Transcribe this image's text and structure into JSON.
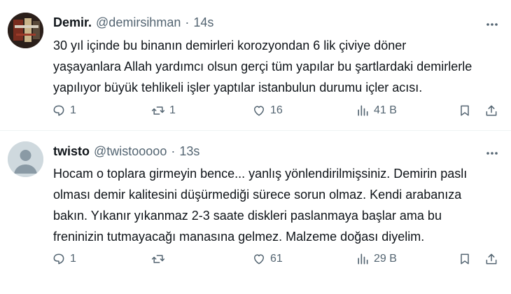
{
  "tweets": [
    {
      "name": "Demir.",
      "handle": "@demirsihman",
      "separator": "·",
      "time": "14s",
      "lines": [
        "30 yıl içinde bu binanın demirleri korozyondan 6 lik çiviye döner",
        "yaşayanlara Allah yardımcı olsun gerçi tüm yapılar bu şartlardaki demirlerle",
        "yapılıyor büyük tehlikeli işler yaptılar istanbulun durumu içler acısı."
      ],
      "replies": "1",
      "reposts": "1",
      "likes": "16",
      "views": "41 B",
      "avatar_icon": "profile-photo"
    },
    {
      "name": "twisto",
      "handle": "@twistooooo",
      "separator": "·",
      "time": "13s",
      "lines": [
        "Hocam o toplara girmeyin bence... yanlış yönlendirilmişsiniz. Demirin paslı",
        "olması demir kalitesini düşürmediği sürece sorun olmaz. Kendi arabanıza",
        "bakın. Yıkanır yıkanmaz 2-3 saate diskleri paslanmaya başlar ama bu",
        "freninizin tutmayacağı manasına gelmez. Malzeme doğası diyelim."
      ],
      "replies": "1",
      "reposts": "",
      "likes": "61",
      "views": "29 B",
      "avatar_icon": "default-avatar-icon"
    }
  ],
  "colors": {
    "text": "#0f1419",
    "secondary": "#536471",
    "divider": "#eff3f4"
  }
}
